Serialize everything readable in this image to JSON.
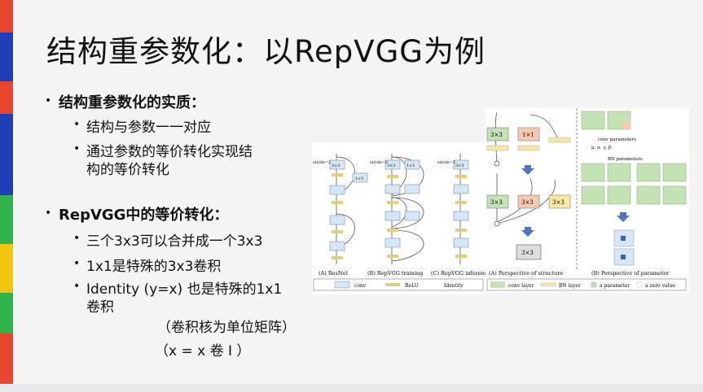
{
  "slide": {
    "title": "结构重参数化：以RepVGG为例",
    "bullets": [
      {
        "text": "结构重参数化的实质：",
        "sub": [
          "结构与参数一一对应",
          "通过参数的等价转化实现结",
          "构的等价转化"
        ]
      },
      {
        "text": "RepVGG中的等价转化：",
        "sub": [
          "三个3x3可以合并成一个3x3",
          "1x1是特殊的3x3卷积",
          "Identity (y=x) 也是特殊的1x1",
          "卷积"
        ]
      }
    ],
    "notes": [
      "（卷积核为单位矩阵）",
      "（x = x 卷 I ）"
    ]
  },
  "figure_left": {
    "stride": "stride=2",
    "k3": "3×3",
    "k1": "1×1",
    "captions": [
      "(A) ResNet",
      "(B) RepVGG training",
      "(C) RepVGG inference"
    ],
    "legend": [
      "conv",
      "ReLU",
      "Identity"
    ]
  },
  "figure_right": {
    "k3": "3×3",
    "k1": "1×1",
    "conv_params": "conv parameters",
    "bn_params": "BN parameters",
    "bn_letters": "μ, σ, γ, β",
    "captions": [
      "(A) Perspective of structure",
      "(B) Perspective of parameter"
    ],
    "legend": [
      "conv layer",
      "BN layer",
      "a parameter",
      "a zero value"
    ]
  },
  "colors": {
    "accent_red": "#e8442e",
    "strip_blue": "#1f3fb8",
    "strip_green": "#2fb34a",
    "strip_yellow": "#f1c40f",
    "box_green": "#c4e3b5",
    "box_salmon": "#f7c9b4",
    "box_yellow": "#fbe7a6",
    "arrow_blue": "#4f75c7"
  }
}
